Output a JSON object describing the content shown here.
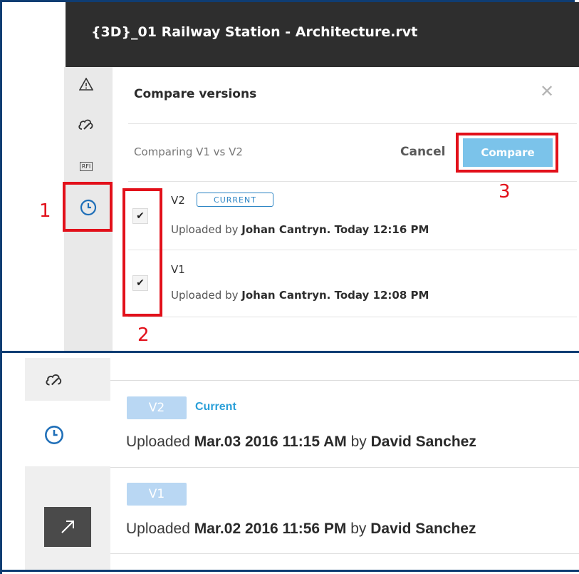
{
  "top": {
    "file_title": "{3D}_01 Railway Station - Architecture.rvt",
    "tools": {
      "warning_icon": "warning-icon",
      "markup_icon": "markup-cloud-icon",
      "rfi_label": "RFI",
      "history_icon": "clock-icon"
    },
    "panel": {
      "title": "Compare versions",
      "close_glyph": "✕",
      "comparing_text": "Comparing V1 vs V2",
      "cancel_label": "Cancel",
      "compare_label": "Compare",
      "versions": [
        {
          "name": "V2",
          "badge": "CURRENT",
          "checked": true,
          "prefix": "Uploaded by ",
          "author": "Johan Cantryn",
          "sep": ". ",
          "time": "Today 12:16 PM"
        },
        {
          "name": "V1",
          "badge": "",
          "checked": true,
          "prefix": "Uploaded by ",
          "author": "Johan Cantryn",
          "sep": ". ",
          "time": "Today 12:08 PM"
        }
      ]
    },
    "annotations": {
      "step1": "1",
      "step2": "2",
      "step3": "3"
    }
  },
  "bottom": {
    "tools": {
      "markup_icon": "markup-cloud-icon",
      "history_icon": "clock-icon",
      "expand_icon": "expand-arrow-icon"
    },
    "versions": [
      {
        "name": "V2",
        "status": "Current",
        "prefix": "Uploaded ",
        "date": "Mar.03 2016 11:15 AM",
        "by": " by ",
        "author": "David Sanchez"
      },
      {
        "name": "V1",
        "status": "",
        "prefix": "Uploaded ",
        "date": "Mar.02 2016 11:56 PM",
        "by": " by ",
        "author": "David Sanchez"
      }
    ]
  },
  "colors": {
    "highlight_red": "#e2101a",
    "compare_blue": "#7bc3ea",
    "current_blue": "#2a9fd8",
    "frame_navy": "#0f3d73"
  }
}
